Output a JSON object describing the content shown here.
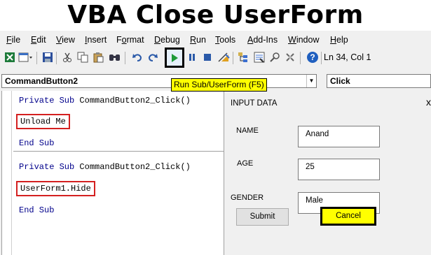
{
  "banner": {
    "title": "VBA Close UserForm"
  },
  "menu": [
    {
      "pre": "",
      "u": "F",
      "post": "ile"
    },
    {
      "pre": "",
      "u": "E",
      "post": "dit"
    },
    {
      "pre": "",
      "u": "V",
      "post": "iew"
    },
    {
      "pre": "",
      "u": "I",
      "post": "nsert"
    },
    {
      "pre": "F",
      "u": "o",
      "post": "rmat"
    },
    {
      "pre": "",
      "u": "D",
      "post": "ebug"
    },
    {
      "pre": "",
      "u": "R",
      "post": "un"
    },
    {
      "pre": "",
      "u": "T",
      "post": "ools"
    },
    {
      "pre": "",
      "u": "A",
      "post": "dd-Ins"
    },
    {
      "pre": "",
      "u": "W",
      "post": "indow"
    },
    {
      "pre": "",
      "u": "H",
      "post": "elp"
    }
  ],
  "toolbar": {
    "status": "Ln 34, Col 1",
    "icons": [
      "excel-icon",
      "insert-userform-icon",
      "save-icon",
      "cut-icon",
      "copy-icon",
      "paste-icon",
      "find-icon",
      "undo-icon",
      "redo-icon",
      "run-icon",
      "break-icon",
      "reset-icon",
      "design-mode-icon",
      "project-explorer-icon",
      "properties-icon",
      "object-browser-icon",
      "toolbox-icon",
      "help-icon"
    ]
  },
  "object_combo": {
    "value": "CommandButton2"
  },
  "procedure_combo": {
    "value": "Click"
  },
  "tooltip": {
    "text": "Run Sub/UserForm (F5)"
  },
  "code": {
    "block1": {
      "kw": "Private Sub",
      "sig": " CommandButton2_Click()",
      "body": "Unload Me",
      "end": "End Sub"
    },
    "block2": {
      "kw": "Private Sub",
      "sig": " CommandButton2_Click()",
      "body": "UserForm1.Hide",
      "end": "End Sub"
    }
  },
  "userform": {
    "title": "INPUT DATA",
    "close": "x",
    "fields": [
      {
        "label": "NAME",
        "value": "Anand"
      },
      {
        "label": "AGE",
        "value": "25"
      },
      {
        "label": "GENDER",
        "value": "Male"
      }
    ],
    "submit_label": "Submit",
    "cancel_label": "Cancel"
  },
  "colors": {
    "highlight_box": "#d42020",
    "tooltip_bg": "#ffff00",
    "cancel_bg": "#ffff00",
    "keyword": "#00008b"
  }
}
